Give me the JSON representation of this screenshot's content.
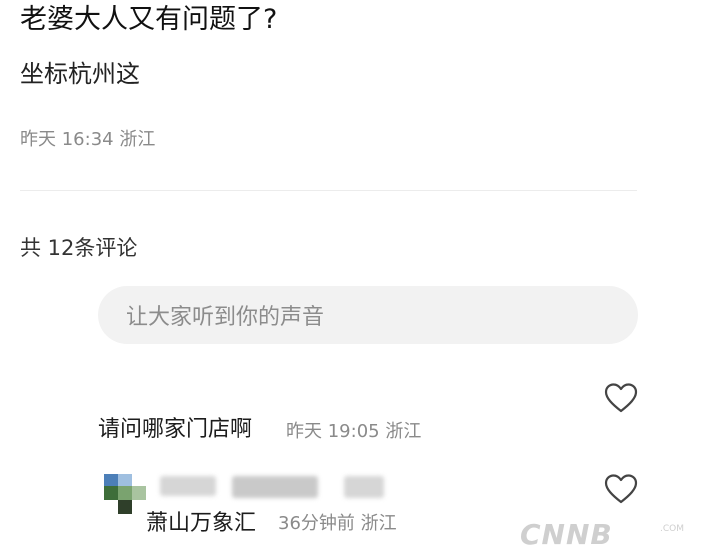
{
  "post": {
    "title": "老婆大人又有问题了?",
    "body": "坐标杭州这",
    "meta": "昨天 16:34 浙江"
  },
  "comments_section": {
    "count_label": "共 12条评论",
    "input_placeholder": "让大家听到你的声音"
  },
  "comments": [
    {
      "text": "请问哪家门店啊",
      "meta": "昨天 19:05 浙江"
    },
    {
      "text": "萧山万象汇",
      "meta": "36分钟前 浙江"
    }
  ],
  "watermark": {
    "text": "CNNB",
    "suffix": ".COM"
  },
  "icons": {
    "like": "heart-outline-icon"
  },
  "colors": {
    "meta_text": "#8a8a8a",
    "input_bg": "#f2f2f2",
    "divider": "#ececec"
  }
}
